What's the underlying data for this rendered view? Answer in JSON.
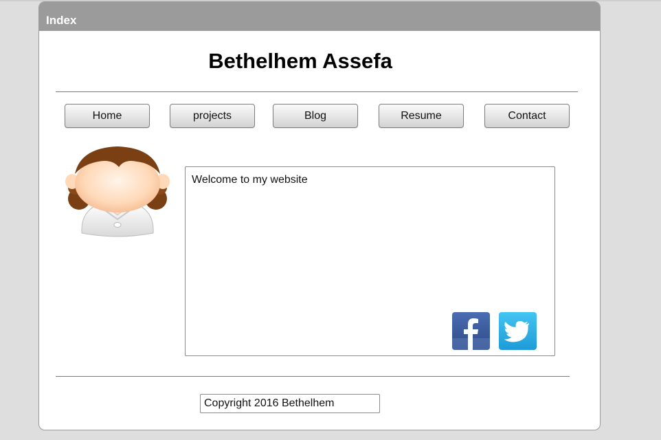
{
  "window": {
    "title": "Index"
  },
  "header": {
    "site_title": "Bethelhem Assefa"
  },
  "nav": {
    "items": [
      {
        "label": "Home"
      },
      {
        "label": "projects"
      },
      {
        "label": "Blog"
      },
      {
        "label": "Resume"
      },
      {
        "label": "Contact"
      }
    ]
  },
  "main": {
    "welcome_text": "Welcome to my website",
    "avatar_icon": "female-avatar-icon",
    "social": [
      {
        "icon": "facebook-icon",
        "color": "#3b5998"
      },
      {
        "icon": "twitter-icon",
        "color": "#2aa9e0"
      }
    ]
  },
  "footer": {
    "copyright": "Copyright 2016 Bethelhem"
  },
  "colors": {
    "titlebar": "#9b9b9b",
    "page_background": "#dedede",
    "window_background": "#ffffff"
  }
}
